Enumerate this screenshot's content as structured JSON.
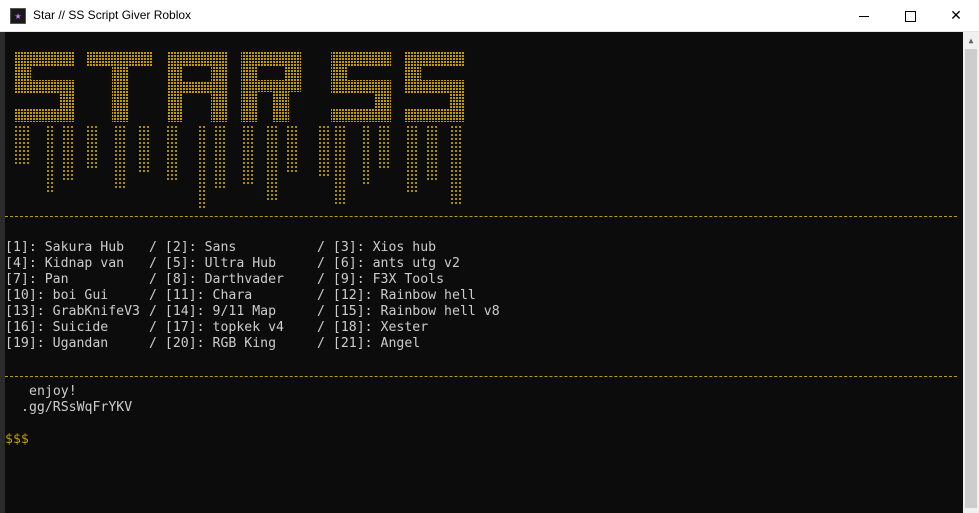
{
  "window": {
    "title": "Star // SS Script Giver Roblox",
    "icon": "star-app-icon",
    "controls": [
      "minimize-icon",
      "maximize-icon",
      "close-icon"
    ]
  },
  "banner": {
    "text": "STAR SS",
    "color": "#c19c00"
  },
  "menu": {
    "separator": "/",
    "items": [
      [
        "[1]: Sakura Hub",
        "[2]: Sans",
        "[3]: Xios hub"
      ],
      [
        "[4]: Kidnap van",
        "[5]: Ultra Hub",
        "[6]: ants utg v2"
      ],
      [
        "[7]: Pan",
        "[8]: Darthvader",
        "[9]: F3X Tools"
      ],
      [
        "[10]: boi Gui",
        "[11]: Chara",
        "[12]: Rainbow hell"
      ],
      [
        "[13]: GrabKnifeV3",
        "[14]: 9/11 Map",
        "[15]: Rainbow hell v8"
      ],
      [
        "[16]: Suicide",
        "[17]: topkek v4",
        "[18]: Xester"
      ],
      [
        "[19]: Ugandan",
        "[20]: RGB King",
        "[21]: Angel"
      ]
    ]
  },
  "footer": {
    "message": "enjoy!",
    "invite": ".gg/RSsWqFrYKV",
    "prompt": "$$$"
  },
  "colors": {
    "background": "#0c0c0c",
    "text": "#cccccc",
    "accent": "#c19c00"
  }
}
